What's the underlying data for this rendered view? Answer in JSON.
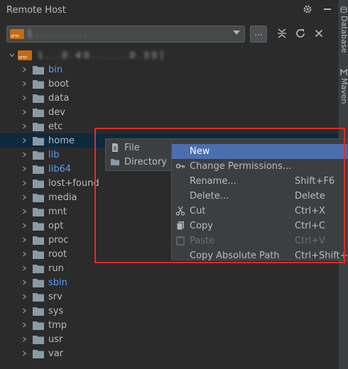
{
  "window": {
    "title": "Remote Host"
  },
  "toolbar": {
    "host_value": "1 . . . . . . . . . .",
    "more_label": "...",
    "icons": [
      "settings-icon",
      "minimize-icon",
      "collapse-icon",
      "refresh-icon",
      "close-icon"
    ]
  },
  "side_tabs": {
    "database": "Database",
    "maven": "Maven"
  },
  "tree": {
    "root_label": "1 . . . 0 . 4 0 . . . . . . . 0 . 3 0 ]",
    "folders": [
      {
        "name": "bin",
        "link": true
      },
      {
        "name": "boot",
        "link": false
      },
      {
        "name": "data",
        "link": false
      },
      {
        "name": "dev",
        "link": false
      },
      {
        "name": "etc",
        "link": false
      },
      {
        "name": "home",
        "link": false,
        "selected": true
      },
      {
        "name": "lib",
        "link": true
      },
      {
        "name": "lib64",
        "link": true
      },
      {
        "name": "lost+found",
        "link": false
      },
      {
        "name": "media",
        "link": false
      },
      {
        "name": "mnt",
        "link": false
      },
      {
        "name": "opt",
        "link": false
      },
      {
        "name": "proc",
        "link": false
      },
      {
        "name": "root",
        "link": false
      },
      {
        "name": "run",
        "link": false
      },
      {
        "name": "sbin",
        "link": true
      },
      {
        "name": "srv",
        "link": false
      },
      {
        "name": "sys",
        "link": false
      },
      {
        "name": "tmp",
        "link": false
      },
      {
        "name": "usr",
        "link": false
      },
      {
        "name": "var",
        "link": false
      }
    ]
  },
  "submenu": {
    "items": [
      {
        "label": "File",
        "icon": "file-icon"
      },
      {
        "label": "Directory",
        "icon": "folder-icon"
      }
    ]
  },
  "context_menu": {
    "items": [
      {
        "label": "New",
        "shortcut": "",
        "active": true,
        "disabled": false,
        "icon": ""
      },
      {
        "label": "Change Permissions...",
        "shortcut": "",
        "active": false,
        "disabled": false,
        "icon": "key-icon"
      },
      {
        "label": "Rename...",
        "shortcut": "Shift+F6",
        "active": false,
        "disabled": false,
        "icon": ""
      },
      {
        "label": "Delete...",
        "shortcut": "Delete",
        "active": false,
        "disabled": false,
        "icon": ""
      },
      {
        "label": "Cut",
        "shortcut": "Ctrl+X",
        "active": false,
        "disabled": false,
        "icon": "scissors-icon"
      },
      {
        "label": "Copy",
        "shortcut": "Ctrl+C",
        "active": false,
        "disabled": false,
        "icon": "copy-icon"
      },
      {
        "label": "Paste",
        "shortcut": "Ctrl+V",
        "active": false,
        "disabled": true,
        "icon": "clipboard-icon"
      },
      {
        "label": "Copy Absolute Path",
        "shortcut": "Ctrl+Shift+C",
        "active": false,
        "disabled": false,
        "icon": ""
      }
    ]
  },
  "colors": {
    "background": "#2b2b2b",
    "panel": "#3c3f41",
    "menu_highlight": "#4b6eaf",
    "selection": "#0d293e",
    "link_text": "#589df6",
    "annotation_border": "#e02b2b",
    "folder": "#8a9aa6"
  }
}
